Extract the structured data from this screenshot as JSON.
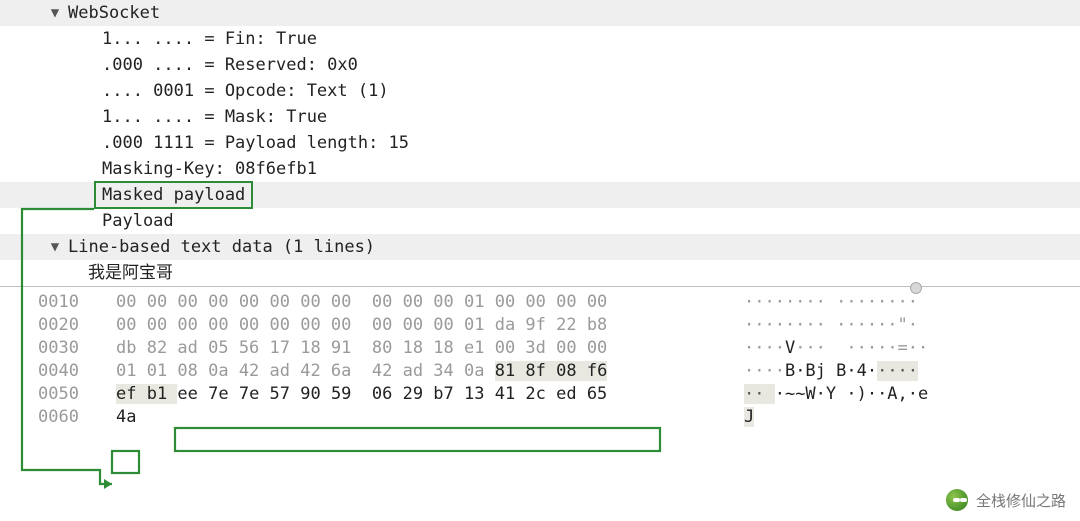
{
  "tree": {
    "ws_header": "WebSocket",
    "fin": "1... .... = Fin: True",
    "reserved": ".000 .... = Reserved: 0x0",
    "opcode": ".... 0001 = Opcode: Text (1)",
    "mask": "1... .... = Mask: True",
    "paylen": ".000 1111 = Payload length: 15",
    "maskkey": "Masking-Key: 08f6efb1",
    "masked": "Masked payload",
    "payload": "Payload",
    "linehdr": "Line-based text data (1 lines)",
    "linetext": "我是阿宝哥"
  },
  "hex": {
    "r0010": {
      "off": "0010",
      "b1": "00 00 00 00 00 00 00 00",
      "b2": "00 00 00 01 00 00 00 00",
      "ascii": "········ ········"
    },
    "r0020": {
      "off": "0020",
      "b1": "00 00 00 00 00 00 00 00",
      "b2": "00 00 00 01 da 9f 22 b8",
      "ascii": "········ ······\"·"
    },
    "r0030": {
      "off": "0030",
      "b1": "db 82 ad 05 56 17 18 91",
      "b2": "80 18 18 e1 00 3d 00 00",
      "ascii_dim": "····",
      "ascii_mid": "V",
      "ascii_rest": "···  ·····=··"
    },
    "r0040": {
      "off": "0040",
      "b1": "01 01 08 0a 42 ad 42 6a",
      "b2": "42 ad 34 0a 81 8f 08 f6",
      "ascii_pre": "····",
      "ascii_mid": "B·Bj B·4·",
      "ascii_post": "····"
    },
    "r0050": {
      "off": "0050",
      "b1": "ef b1 ",
      "sel": "ee 7e 7e 57 90 59  06 29 b7 13 41 2c ed 65",
      "ascii_pre": "·· ",
      "ascii_sel": "·~~W·Y ·)··A,·e"
    },
    "r0060": {
      "off": "0060",
      "sel": "4a",
      "ascii": "J"
    }
  },
  "watermark": "全栈修仙之路"
}
